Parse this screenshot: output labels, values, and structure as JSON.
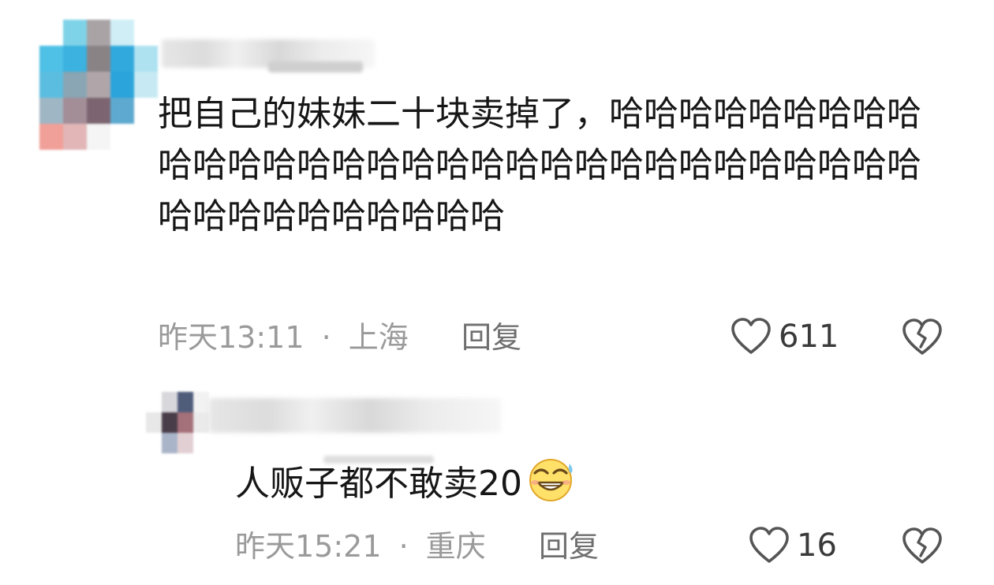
{
  "comments": [
    {
      "text": "把自己的妹妹二十块卖掉了，哈哈哈哈哈哈哈哈哈哈哈哈哈哈哈哈哈哈哈哈哈哈哈哈哈哈哈哈哈哈哈哈哈哈哈哈哈哈哈哈哈",
      "time": "昨天13:11",
      "separator": "·",
      "location": "上海",
      "reply_label": "回复",
      "likes": "611",
      "emoji": ""
    },
    {
      "text": "人贩子都不敢卖20",
      "time": "昨天15:21",
      "separator": "·",
      "location": "重庆",
      "reply_label": "回复",
      "likes": "16",
      "emoji": "grinning-sweat-emoji"
    }
  ],
  "colors": {
    "text": "#161616",
    "meta": "#9a9a9a",
    "reply": "#6f6f6f",
    "icon": "#555555"
  }
}
